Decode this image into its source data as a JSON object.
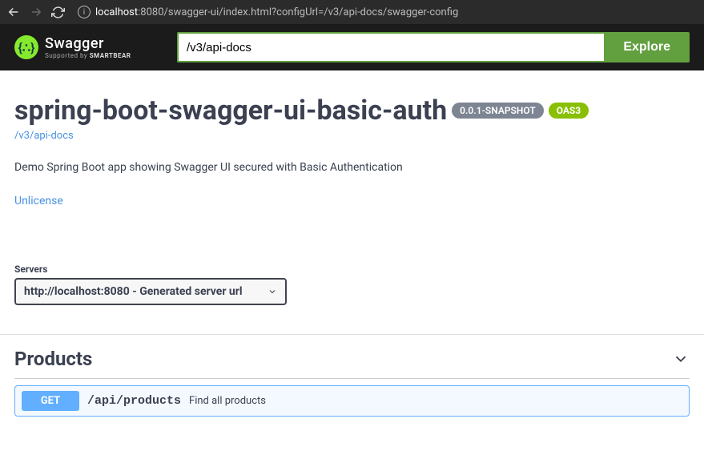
{
  "browser": {
    "url_host": "localhost",
    "url_rest": ":8080/swagger-ui/index.html?configUrl=/v3/api-docs/swagger-config"
  },
  "topbar": {
    "logo_main": "Swagger",
    "logo_sub_prefix": "Supported by ",
    "logo_sub_brand": "SMARTBEAR",
    "search_value": "/v3/api-docs",
    "explore_label": "Explore"
  },
  "info": {
    "title": "spring-boot-swagger-ui-basic-auth",
    "version": "0.0.1-SNAPSHOT",
    "oas_label": "OAS3",
    "docs_link": "/v3/api-docs",
    "description": "Demo Spring Boot app showing Swagger UI secured with Basic Authentication",
    "license": "Unlicense"
  },
  "servers": {
    "label": "Servers",
    "selected": "http://localhost:8080 - Generated server url"
  },
  "tag": {
    "name": "Products"
  },
  "operation": {
    "method": "GET",
    "path": "/api/products",
    "summary": "Find all products"
  }
}
